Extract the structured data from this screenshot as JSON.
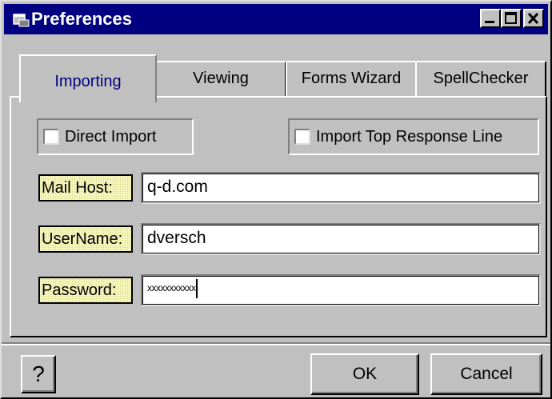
{
  "window": {
    "title": "Preferences",
    "controls": {
      "minimize_icon": "minimize-icon",
      "maximize_icon": "maximize-icon",
      "close_icon": "close-icon"
    }
  },
  "tabs": [
    {
      "label": "Importing",
      "active": true
    },
    {
      "label": "Viewing",
      "active": false
    },
    {
      "label": "Forms Wizard",
      "active": false
    },
    {
      "label": "SpellChecker",
      "active": false
    }
  ],
  "options": {
    "direct_import": {
      "label": "Direct Import",
      "checked": false
    },
    "import_top_response_line": {
      "label": "Import Top Response Line",
      "checked": false
    }
  },
  "fields": {
    "mail_host": {
      "label": "Mail Host:",
      "value": "q-d.com"
    },
    "username": {
      "label": "UserName:",
      "value": "dversch"
    },
    "password": {
      "label": "Password:",
      "value": "xxxxxxxxxxx"
    }
  },
  "buttons": {
    "help_glyph": "?",
    "ok": "OK",
    "cancel": "Cancel"
  },
  "colors": {
    "titlebar": "#000080",
    "face": "#c0c0c0",
    "label_bg": "#ffffcc",
    "active_tab_text": "#000080"
  }
}
